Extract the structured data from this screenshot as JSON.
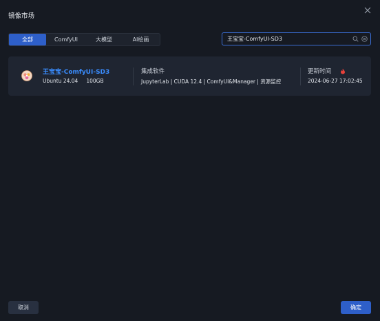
{
  "dialog": {
    "title": "镜像市场"
  },
  "tabs": [
    {
      "label": "全部",
      "active": true
    },
    {
      "label": "ComfyUI",
      "active": false
    },
    {
      "label": "大模型",
      "active": false
    },
    {
      "label": "AI绘画",
      "active": false
    }
  ],
  "search": {
    "value": "王宝宝-ComfyUI-SD3",
    "placeholder": ""
  },
  "image_card": {
    "name": "王宝宝-ComfyUI-SD3",
    "os": "Ubuntu 24.04",
    "size": "100GB",
    "software_label": "集成软件",
    "software_value": "JupyterLab | CUDA 12.4 | ComfyUI&Manager | 资源监控",
    "updated_label": "更新时间",
    "updated_value": "2024-06-27 17:02:45"
  },
  "footer": {
    "cancel_label": "取消",
    "confirm_label": "确定"
  },
  "colors": {
    "accent": "#2e5fc9",
    "link": "#3a8dff",
    "background": "#161a22",
    "card": "#1f2531",
    "hot": "#e8413a"
  },
  "icons": {
    "close": "close-icon",
    "search": "search-icon",
    "clear": "clear-circle-icon",
    "avatar": "image-avatar-icon",
    "hot": "fire-icon"
  }
}
